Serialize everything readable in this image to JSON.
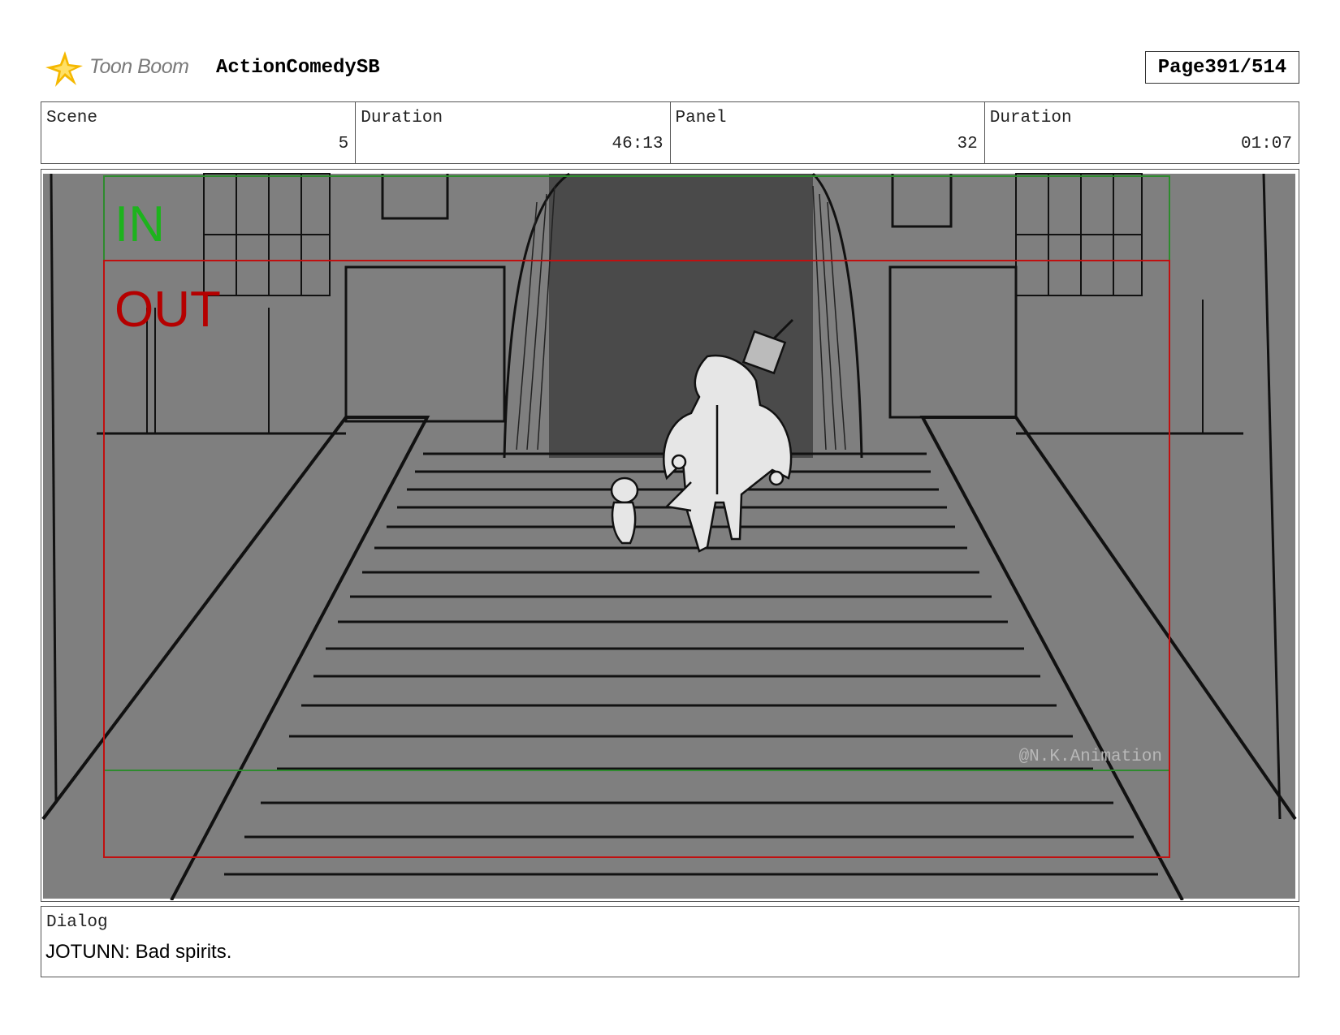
{
  "header": {
    "brand": "Toon Boom",
    "project": "ActionComedySB",
    "page_label": "Page",
    "page_value": "391/514"
  },
  "info": {
    "scene_label": "Scene",
    "scene_value": "5",
    "scene_duration_label": "Duration",
    "scene_duration_value": "46:13",
    "panel_label": "Panel",
    "panel_value": "32",
    "panel_duration_label": "Duration",
    "panel_duration_value": "01:07"
  },
  "panel": {
    "in_label": "IN",
    "out_label": "OUT",
    "watermark": "@N.K.Animation",
    "in_color": "#1db31d",
    "out_color": "#b50000"
  },
  "dialog": {
    "label": "Dialog",
    "text": "JOTUNN: Bad spirits."
  }
}
